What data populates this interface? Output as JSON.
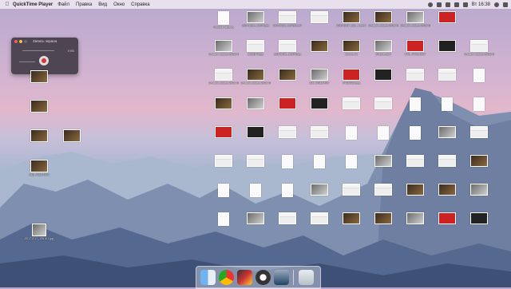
{
  "menubar": {
    "apple_icon": "apple-logo-icon",
    "app_name": "QuickTime Player",
    "menus": [
      "Файл",
      "Правка",
      "Вид",
      "Окно",
      "Справка"
    ],
    "clock": "Вт 16:38"
  },
  "quicktime": {
    "title": "Запись экрана",
    "file_size": "0 КБ"
  },
  "left_icons": [
    {
      "label": "",
      "kind": "video"
    },
    {
      "label": "",
      "kind": "video"
    },
    {
      "label": "",
      "kind": "video"
    },
    {
      "label": "",
      "kind": "video"
    },
    {
      "label": "IMG_4311.MOV",
      "kind": "video"
    }
  ],
  "bottom_left_icon": {
    "label": "20171217_135101.jpg"
  },
  "desktop_grid_labels": [
    "Снимок экрана",
    "20171216_13570.jpg",
    "20171216_16420.mp4",
    "20171217_121...1.mp4",
    "Снимок экрана 2016-01...5.40.24",
    "Снимок экрана 2016-01...10.56.54",
    "Снимок экрана 2016-01...14.56.44",
    "1066144.jpg",
    "20171216_13570.jpg",
    "Iphone 11",
    "iPhone.mp4",
    "IMG_4443.MOV",
    "Снимок экрана 2016-01...11.25.21",
    "Снимок экрана 2016-01...19.58.32",
    "Снимок экрана 2016-01...16.20.55",
    "DJI_0016.MOV",
    "64228336.jpg"
  ],
  "dock": {
    "items": [
      "finder-icon",
      "chrome-icon",
      "final-cut-icon",
      "obs-icon",
      "quicktime-icon",
      "trash-icon"
    ]
  }
}
